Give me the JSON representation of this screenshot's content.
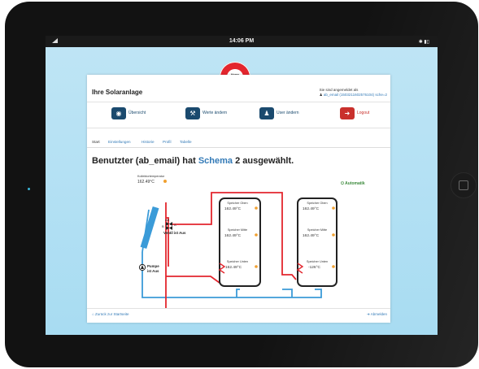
{
  "statusbar": {
    "time": "14:06 PM",
    "battery": "✱ ▮▯"
  },
  "logo": {
    "line1": "Home",
    "line2": "Control",
    "line3": "Center"
  },
  "app": {
    "title": "Ihre Solaranlage",
    "login_line1": "Sie sind angemeldet als",
    "login_line2": "ab_email (1503211602576104) sche=2"
  },
  "nav": {
    "overview": "Übersicht",
    "values": "Werte ändern",
    "user": "User ändern",
    "logout": "Logout"
  },
  "tabs": [
    "Start",
    "Einstellungen",
    "Historie",
    "Profil",
    "Tabelle"
  ],
  "heading": {
    "before": "Benutzter (ab_email) hat ",
    "schema": "Schema",
    "after": " 2 ausgewählt."
  },
  "mode": "⏻ Automatik",
  "diagram": {
    "collector_label": "Kollektortemperatur",
    "collector_temp": "162.49°C",
    "valve_b": "B",
    "valve_ab": "AB",
    "valve_a": "A",
    "valve_label": "Ventil ist Aus",
    "pump_label1": "Pumpe",
    "pump_label2": "ist Aus",
    "tank1": {
      "top_label": "Speicher Oben",
      "top_temp": "162.49°C",
      "mid_label": "Speicher Mitte",
      "mid_temp": "162.49°C",
      "bot_label": "Speicher Unten",
      "bot_temp": "162.49°C"
    },
    "tank2": {
      "top_label": "Speicher Oben",
      "top_temp": "162.49°C",
      "mid_label": "Speicher Mitte",
      "mid_temp": "162.49°C",
      "bot_label": "Speicher Unten",
      "bot_temp": "-126°C"
    }
  },
  "footer": {
    "back": "Zurück zur Startseite",
    "logout": "Abmelden"
  },
  "colors": {
    "hot": "#e3262e",
    "cold": "#3b9bd8",
    "accent": "#337ab7",
    "nav": "#1a4a6e",
    "logout": "#c9302c"
  }
}
